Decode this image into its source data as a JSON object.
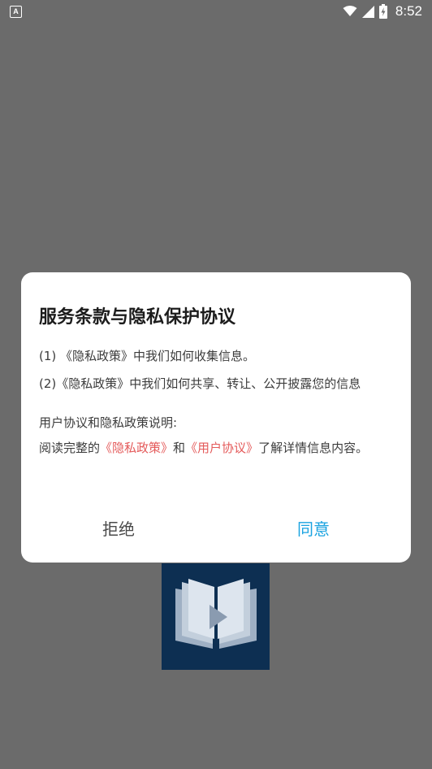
{
  "status_bar": {
    "notification_icon_letter": "A",
    "notification_icon": "accessibility-app-icon",
    "icons": [
      "wifi-icon",
      "signal-icon",
      "battery-charging-icon"
    ],
    "time": "8:52"
  },
  "background": {
    "splash_logo_icon": "book-play-logo-icon",
    "splash_logo_color": "#0d2f52"
  },
  "dialog": {
    "title": "服务条款与隐私保护协议",
    "line1": "(1) 《隐私政策》中我们如何收集信息。",
    "line2": "(2)《隐私政策》中我们如何共享、转让、公开披露您的信息",
    "section_heading": "用户协议和隐私政策说明:",
    "desc_prefix": "阅读完整的",
    "privacy_link": "《隐私政策》",
    "desc_and": "和",
    "user_agreement_link": "《用户协议》",
    "desc_suffix": "了解详情信息内容。",
    "reject_label": "拒绝",
    "agree_label": "同意"
  },
  "colors": {
    "overlay_background": "#6b6b6b",
    "link": "#e45a5a",
    "agree": "#1aa3e0"
  }
}
